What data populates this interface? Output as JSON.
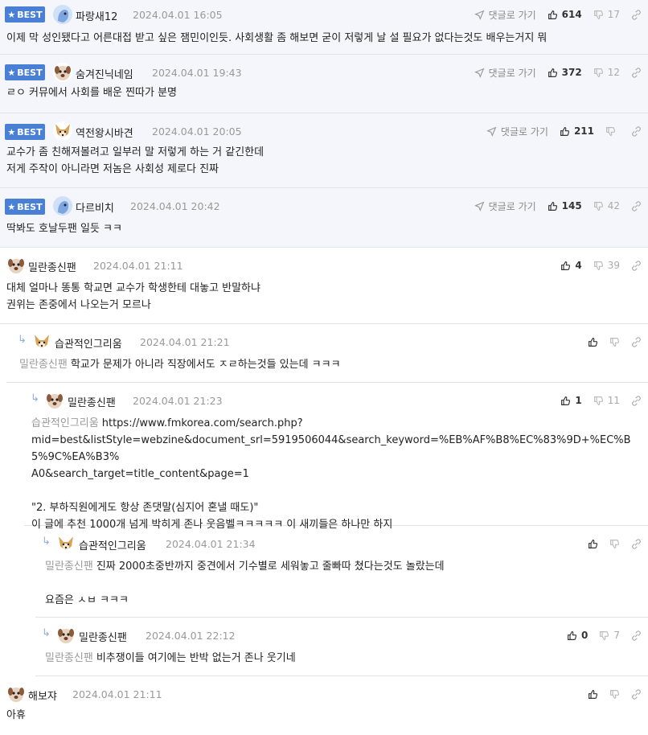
{
  "reply_link_label": "댓글로 가기",
  "best_label": "BEST",
  "comments": [
    {
      "badge": "BEST",
      "nick": "파랑새12",
      "date": "2024.04.01 16:05",
      "up": "614",
      "down": "17",
      "reply": "댓글로 가기",
      "body": "이제 막 성인됐다고 어른대접 받고 싶은 잼민이인듯. 사회생활 좀 해보면 굳이 저렇게 날 설 필요가 없다는것도 배우는거지 뭐"
    },
    {
      "badge": "BEST",
      "nick": "숨겨진닉네임",
      "date": "2024.04.01 19:43",
      "up": "372",
      "down": "12",
      "reply": "댓글로 가기",
      "body": "ㄹㅇ 커뮤에서 사회를 배운 찐따가 분명"
    },
    {
      "badge": "BEST",
      "nick": "역전왕시바견",
      "date": "2024.04.01 20:05",
      "up": "211",
      "down": "",
      "reply": "댓글로 가기",
      "body": "교수가 좀 친해져볼려고 일부러 말 저렇게 하는 거 같긴한데\n저게 주작이 아니라면 저놈은 사회성 제로다 진짜"
    },
    {
      "badge": "BEST",
      "nick": "다르비치",
      "date": "2024.04.01 20:42",
      "up": "145",
      "down": "42",
      "reply": "댓글로 가기",
      "body": "딱봐도 호날두팬 일듯 ㅋㅋ"
    },
    {
      "nick": "밀란종신팬",
      "date": "2024.04.01 21:11",
      "up": "4",
      "down": "39",
      "body": "대체 얼마나 똥통 학교면 교수가 학생한테 대놓고 반말하냐\n권위는 존중에서 나오는거 모르나"
    },
    {
      "nick": "습관적인그리움",
      "date": "2024.04.01 21:21",
      "up": "",
      "down": "",
      "mention": "밀란종신팬",
      "body": "학교가 문제가 아니라 직장에서도 ㅈㄹ하는것들 있는데 ㅋㅋㅋ"
    },
    {
      "nick": "밀란종신팬",
      "date": "2024.04.01 21:23",
      "up": "1",
      "down": "11",
      "mention": "습관적인그리움",
      "body": "https://www.fmkorea.com/search.php?\nmid=best&listStyle=webzine&document_srl=5919506044&search_keyword=%EB%AF%B8%EC%83%9D+%EC%B5%9C%EA%B3%\nA0&search_target=title_content&page=1\n\n\"2. 부하직원에게도 항상 존댓말(심지어 혼낼 때도)\"\n이 글에 추천 1000개 넘게 박히게 존나 웃음벨ㅋㅋㅋㅋㅋ 이 새끼들은 하나만 하지"
    },
    {
      "nick": "습관적인그리움",
      "date": "2024.04.01 21:34",
      "up": "",
      "down": "",
      "mention": "밀란종신팬",
      "body": "진짜 2000초중반까지 중견에서 기수별로 세워놓고 줄빠따 쳤다는것도 놀랐는데\n\n요즘은 ㅅㅂ ㅋㅋㅋ"
    },
    {
      "nick": "밀란종신팬",
      "date": "2024.04.01 22:12",
      "up": "0",
      "down": "7",
      "mention": "밀란종신팬",
      "body": "비추쟁이들 여기에는 반박 없는거 존나 웃기네"
    },
    {
      "nick": "해보쟈",
      "date": "2024.04.01 21:11",
      "up": "",
      "down": "",
      "body": "아휴"
    }
  ],
  "colors": {
    "best_bg": "#f4f6fb",
    "badge": "#4a7fd6",
    "accent_reply": "#8fb0dc"
  }
}
